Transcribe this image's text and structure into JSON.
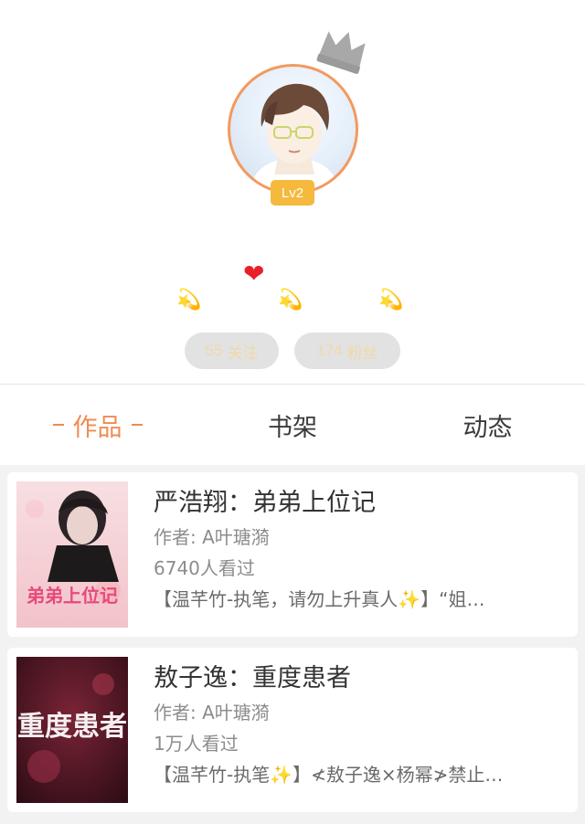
{
  "profile": {
    "level": "Lv2",
    "emoji": {
      "heart": "❤",
      "dizzy": "💫"
    },
    "follow_count": "55",
    "follow_label": "关注",
    "fans_count": "174",
    "fans_label": "粉丝"
  },
  "tabs": [
    {
      "label": "作品",
      "active": true
    },
    {
      "label": "书架",
      "active": false
    },
    {
      "label": "动态",
      "active": false
    }
  ],
  "works": [
    {
      "title": "严浩翔：弟弟上位记",
      "author": "作者: A叶瑭漪",
      "views": "6740人看过",
      "description": "【温芊竹-执笔，请勿上升真人✨】“姐…",
      "cover_text": "弟弟上位记"
    },
    {
      "title": "敖子逸：重度患者",
      "author": "作者: A叶瑭漪",
      "views": "1万人看过",
      "description": "【温芊竹-执笔✨】≮敖子逸×杨幂≯禁止…",
      "cover_text": "重度患者"
    }
  ],
  "colors": {
    "accent": "#f08b52",
    "avatar_ring": "#f3995f",
    "level_badge": "#f5b93d",
    "pill_bg": "#e2e2e2",
    "pill_text": "#efd9a9"
  }
}
